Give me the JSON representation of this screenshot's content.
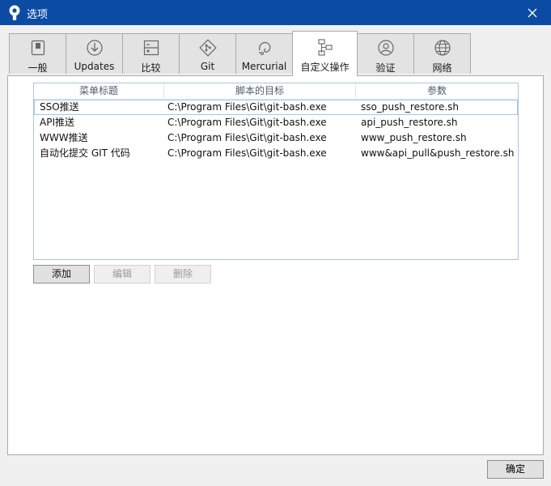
{
  "window": {
    "title": "选项",
    "close_icon": "close-icon"
  },
  "tabs": [
    {
      "label": "一般",
      "icon": "general-icon"
    },
    {
      "label": "Updates",
      "icon": "download-circle-icon"
    },
    {
      "label": "比较",
      "icon": "compare-icon"
    },
    {
      "label": "Git",
      "icon": "git-icon"
    },
    {
      "label": "Mercurial",
      "icon": "mercurial-icon"
    },
    {
      "label": "自定义操作",
      "icon": "custom-actions-icon",
      "active": true
    },
    {
      "label": "验证",
      "icon": "user-icon"
    },
    {
      "label": "网络",
      "icon": "globe-icon"
    }
  ],
  "custom_actions": {
    "columns": [
      "菜单标题",
      "脚本的目标",
      "参数"
    ],
    "rows": [
      [
        "SSO推送",
        "C:\\Program Files\\Git\\git-bash.exe",
        "sso_push_restore.sh"
      ],
      [
        "API推送",
        "C:\\Program Files\\Git\\git-bash.exe",
        "api_push_restore.sh"
      ],
      [
        "WWW推送",
        "C:\\Program Files\\Git\\git-bash.exe",
        "www_push_restore.sh"
      ],
      [
        "自动化提交 GIT 代码",
        "C:\\Program Files\\Git\\git-bash.exe",
        "www&api_pull&push_restore.sh"
      ]
    ],
    "selected_row": 0
  },
  "buttons": {
    "add": "添加",
    "edit": "编辑",
    "delete": "删除",
    "ok": "确定"
  },
  "colors": {
    "titlebar": "#0b4ba3",
    "selection_border": "#a3c8ee"
  }
}
